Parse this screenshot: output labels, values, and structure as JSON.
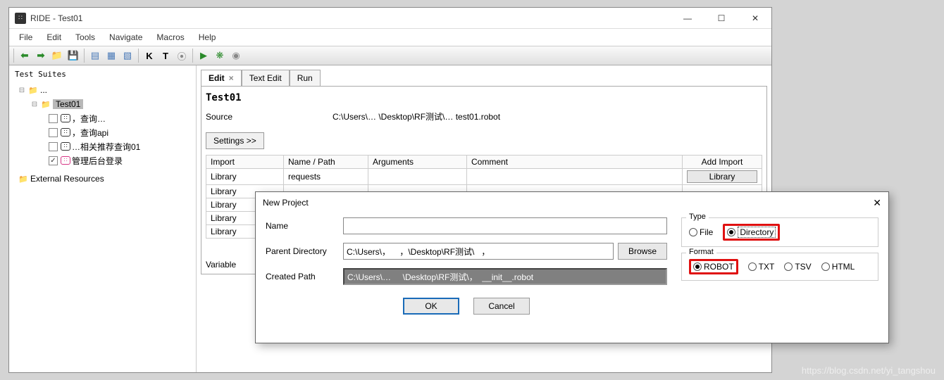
{
  "window": {
    "title": "RIDE - Test01",
    "menu": [
      "File",
      "Edit",
      "Tools",
      "Navigate",
      "Macros",
      "Help"
    ]
  },
  "sidebar": {
    "title": "Test Suites",
    "items": [
      {
        "label": "...",
        "type": "folder",
        "indent": 0,
        "toggle": "−"
      },
      {
        "label": "Test01",
        "type": "folder",
        "indent": 1,
        "toggle": "−",
        "selected": true
      },
      {
        "label": "，查询…",
        "type": "test",
        "indent": 2,
        "checked": false
      },
      {
        "label": "，查询api",
        "type": "test",
        "indent": 2,
        "checked": false
      },
      {
        "label": "…相关推荐查询01",
        "type": "test",
        "indent": 2,
        "checked": false
      },
      {
        "label": "管理后台登录",
        "type": "test",
        "indent": 2,
        "checked": true,
        "pink": true
      }
    ],
    "ext_label": "External Resources"
  },
  "tabs": {
    "edit": "Edit",
    "text_edit": "Text Edit",
    "run": "Run"
  },
  "editor": {
    "title": "Test01",
    "source_label": "Source",
    "source_value": "C:\\Users\\…   \\Desktop\\RF测试\\…   test01.robot",
    "settings_btn": "Settings >>",
    "headers": {
      "import": "Import",
      "name": "Name / Path",
      "args": "Arguments",
      "comment": "Comment",
      "add": "Add Import"
    },
    "rows": [
      {
        "c0": "Library",
        "c1": "requests"
      },
      {
        "c0": "Library",
        "c1": ""
      },
      {
        "c0": "Library",
        "c1": ""
      },
      {
        "c0": "Library",
        "c1": ""
      },
      {
        "c0": "Library",
        "c1": ""
      }
    ],
    "library_btn": "Library",
    "variable_label": "Variable"
  },
  "dialog": {
    "title": "New Project",
    "name_label": "Name",
    "name_value": "",
    "parent_label": "Parent Directory",
    "parent_value": "C:\\Users\\，    ，\\Desktop\\RF测试\\   ，",
    "browse": "Browse",
    "created_label": "Created Path",
    "created_value": "C:\\Users\\…     \\Desktop\\RF测试\\，  __init__.robot",
    "type": {
      "legend": "Type",
      "file": "File",
      "directory": "Directory"
    },
    "format": {
      "legend": "Format",
      "robot": "ROBOT",
      "txt": "TXT",
      "tsv": "TSV",
      "html": "HTML"
    },
    "ok": "OK",
    "cancel": "Cancel"
  },
  "watermark": "https://blog.csdn.net/yi_tangshou"
}
